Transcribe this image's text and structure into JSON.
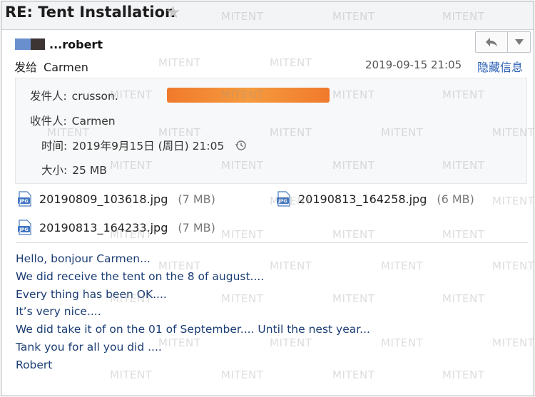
{
  "email": {
    "subject": "RE: Tent Installation",
    "sender_display": "...robert",
    "to_label": "发给",
    "to_name": "Carmen",
    "date": "2019-09-15 21:05",
    "hide_info_link": "隐藏信息"
  },
  "details": {
    "from_label": "发件人:",
    "from_value": "crusson.",
    "to_label": "收件人:",
    "to_value": "Carmen",
    "time_label": "时间:",
    "time_value": "2019年9月15日 (周日) 21:05",
    "size_label": "大小:",
    "size_value": "25 MB"
  },
  "attachments": [
    {
      "name": "20190809_103618.jpg",
      "size": "(7 MB)"
    },
    {
      "name": "20190813_164258.jpg",
      "size": "(6 MB)"
    },
    {
      "name": "20190813_164233.jpg",
      "size": "(7 MB)"
    }
  ],
  "body_lines": [
    "Hello, bonjour Carmen...",
    "We did receive the tent on the 8 of august....",
    "Every thing has been OK....",
    "It’s very nice....",
    "We did take it of on the 01 of September.... Until the nest year...",
    "Tank you for all you did ....",
    "Robert"
  ],
  "watermark": "MITENT",
  "icons": {
    "star": "star-icon",
    "reply": "reply-icon",
    "more": "chevron-down-icon",
    "history": "history-icon",
    "attachment": "jpg-file-icon"
  },
  "colors": {
    "link": "#2a5fb5",
    "body_text": "#1b3d73",
    "redaction": "#f07a2c"
  }
}
